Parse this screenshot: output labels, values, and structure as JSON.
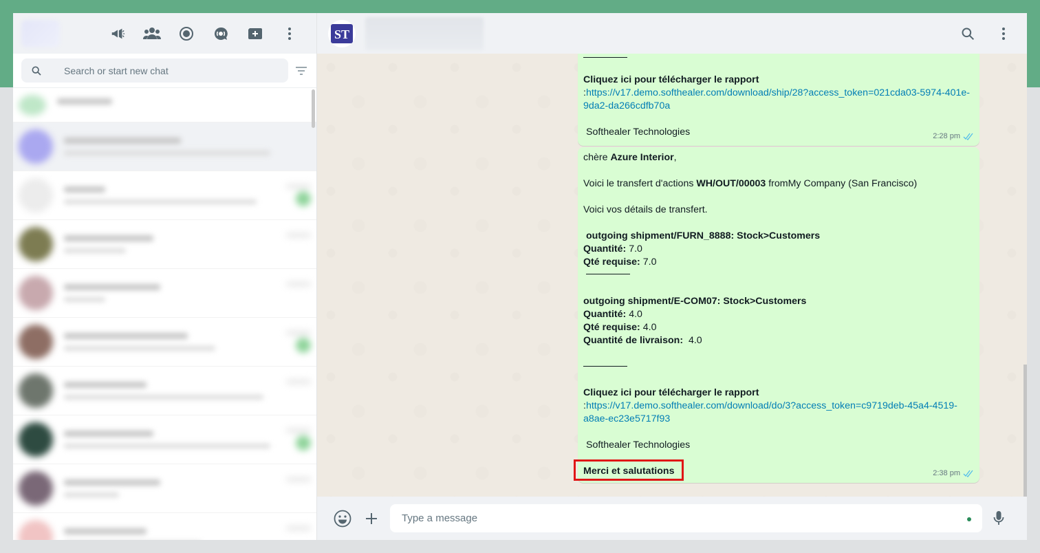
{
  "colors": {
    "brand_green": "#62ac86",
    "bubble_out": "#d9fdd3",
    "link": "#027eb5",
    "highlight_box": "#e01616",
    "read_ticks": "#53bdeb"
  },
  "sidebar": {
    "icons": [
      "megaphone-icon",
      "community-icon",
      "status-icon",
      "channels-icon",
      "new-chat-icon",
      "menu-icon"
    ],
    "search": {
      "placeholder": "Search or start new chat"
    }
  },
  "header": {
    "contact_logo_text": "ST"
  },
  "messages": {
    "first": {
      "link_label": "Cliquez ici pour télécharger le rapport",
      "link_prefix": ":",
      "link": "https://v17.demo.softhealer.com/download/ship/28?access_token=021cda03-5974-401e-",
      "link_cont": "9da2-da266cdfb70a",
      "company": "Softhealer Technologies",
      "time": "2:28 pm"
    },
    "second": {
      "greeting_pre": "chère ",
      "greeting_name": "Azure Interior",
      "greeting_post": ",",
      "transfer_pre": "Voici le transfert d'actions ",
      "transfer_ref": "WH/OUT/00003",
      "transfer_post": " fromMy Company (San Francisco)",
      "details": "Voici vos détails de transfert.",
      "item1_title": "outgoing shipment/FURN_8888: Stock>Customers",
      "item1_qty_label": "Quantité:",
      "item1_qty": " 7.0",
      "item1_req_label": "Qté requise:",
      "item1_req": " 7.0",
      "item2_title": "outgoing shipment/E-COM07: Stock>Customers",
      "item2_qty_label": "Quantité:",
      "item2_qty": " 4.0",
      "item2_req_label": "Qté requise:",
      "item2_req": " 4.0",
      "item2_del_label": "Quantité de livraison:",
      "item2_del": "  4.0",
      "link_label": "Cliquez ici pour télécharger le rapport",
      "link_prefix": ":",
      "link": "https://v17.demo.softhealer.com/download/do/3?access_token=c9719deb-45a4-4519-",
      "link_cont": "a8ae-ec23e5717f93",
      "company": "Softhealer Technologies",
      "closing": "Merci et salutations",
      "time": "2:38 pm"
    }
  },
  "composer": {
    "placeholder": "Type a message"
  }
}
